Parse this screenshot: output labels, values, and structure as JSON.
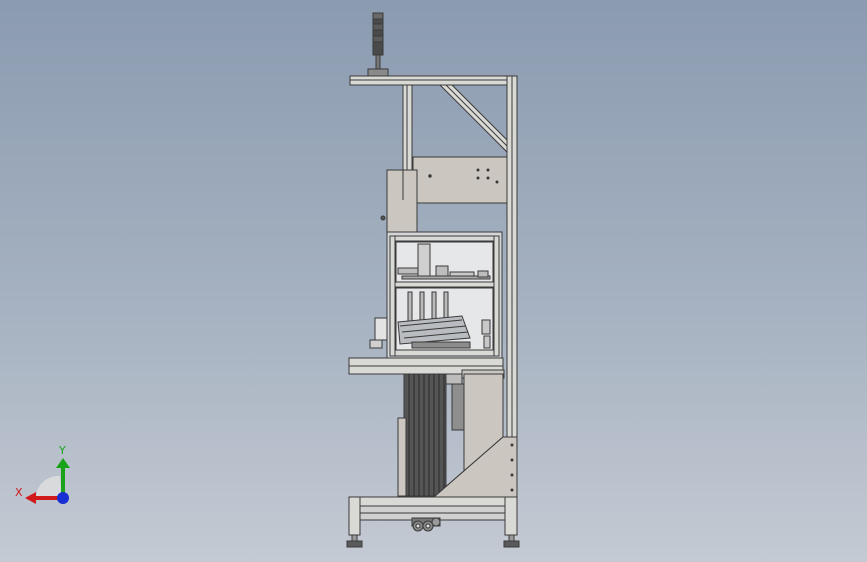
{
  "viewport": {
    "background_top": "#8b9bb0",
    "background_bottom": "#c4cad3"
  },
  "model": {
    "frame_color": "#d9d9d6",
    "panel_color": "#cbc6c0",
    "outline_color": "#3a3a3a",
    "parts": [
      "signal-tower",
      "top-beam",
      "diagonal-brace",
      "upper-panel",
      "guard-cabinet",
      "work-table",
      "drive-column",
      "base-gusset",
      "base-frame",
      "casters",
      "leveling-feet"
    ]
  },
  "triad": {
    "x_label": "X",
    "y_label": "Y",
    "x_color": "#d11a1a",
    "y_color": "#1aa31a",
    "z_color": "#1a2fd1"
  }
}
